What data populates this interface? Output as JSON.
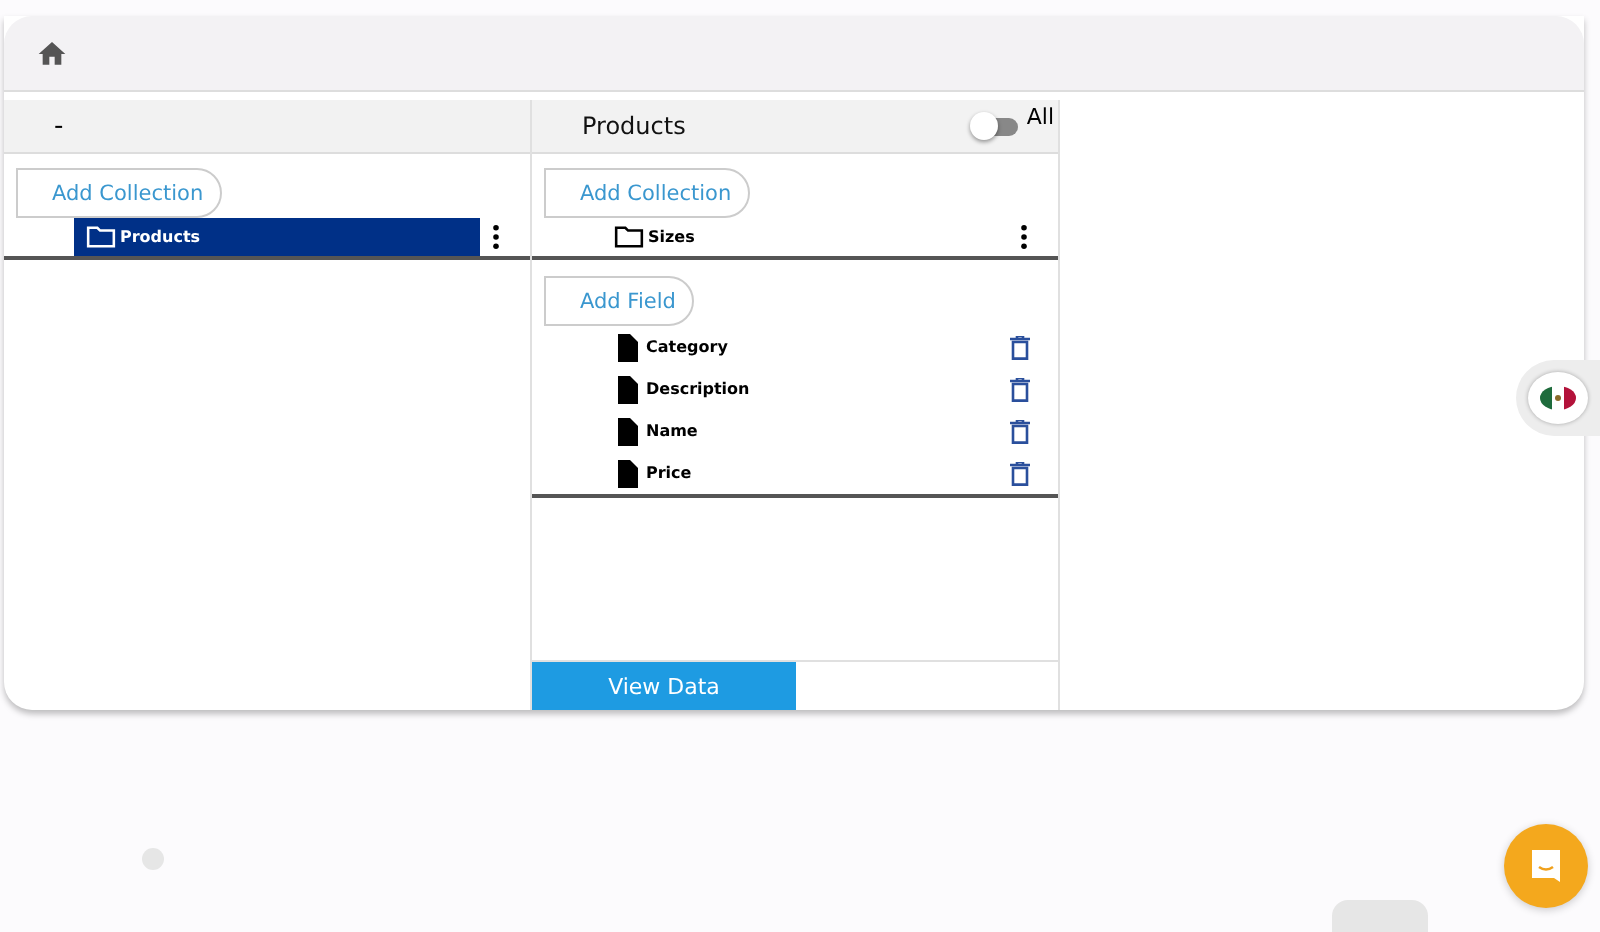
{
  "left_panel": {
    "title": "-",
    "add_button": "Add Collection",
    "collections": [
      {
        "label": "Products",
        "selected": true
      }
    ]
  },
  "middle_panel": {
    "title": "Products",
    "toggle": {
      "label": "All",
      "on": false
    },
    "add_collection_button": "Add Collection",
    "collections": [
      {
        "label": "Sizes",
        "selected": false
      }
    ],
    "add_field_button": "Add Field",
    "fields": [
      {
        "label": "Category"
      },
      {
        "label": "Description"
      },
      {
        "label": "Name"
      },
      {
        "label": "Price"
      }
    ],
    "view_button": "View Data"
  }
}
